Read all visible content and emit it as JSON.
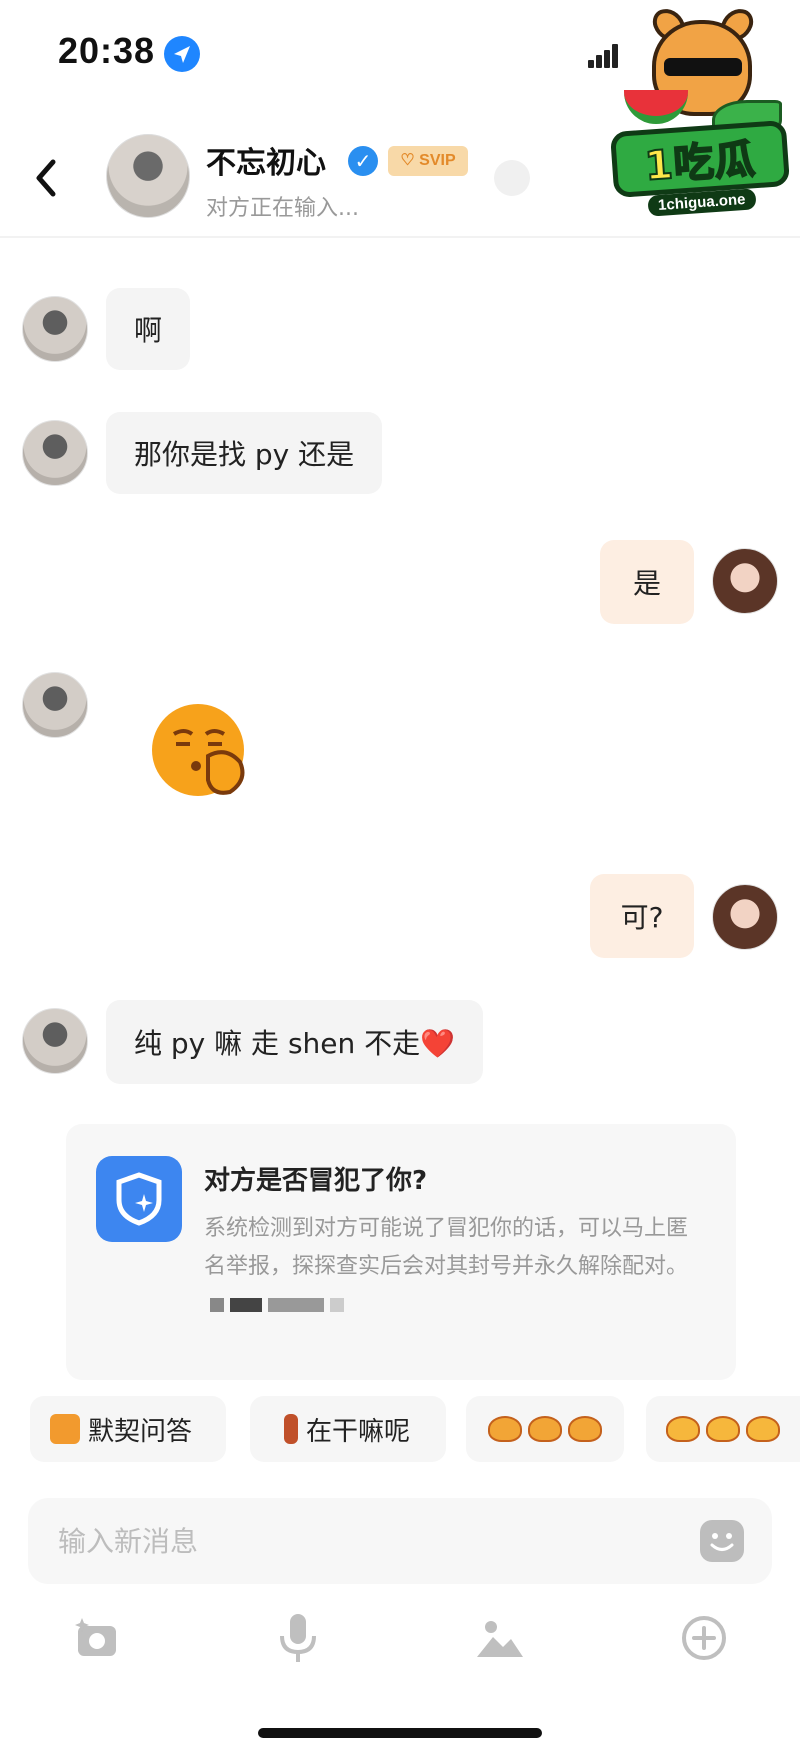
{
  "status_bar": {
    "time": "20:38",
    "location_icon": "location-arrow-icon",
    "signal_icon": "cellular-signal-icon"
  },
  "watermark": {
    "brand": "1吃瓜",
    "url": "1chigua.one"
  },
  "header": {
    "back_icon": "chevron-left-icon",
    "contact_name": "不忘初心",
    "verified_icon": "verified-check-icon",
    "vip_badge": "SVIP",
    "status": "对方正在输入..."
  },
  "messages": [
    {
      "side": "in",
      "text": "啊"
    },
    {
      "side": "in",
      "text": "那你是找 py 还是"
    },
    {
      "side": "out",
      "text": "是"
    },
    {
      "side": "in",
      "emoji": "pensive-finger-emoji"
    },
    {
      "side": "out",
      "text": "可?"
    },
    {
      "side": "in",
      "text": "纯 py 嘛 走 shen 不走❤️"
    }
  ],
  "report_card": {
    "icon": "shield-star-icon",
    "title": "对方是否冒犯了你?",
    "body": "系统检测到对方可能说了冒犯你的话，可以马上匿名举报，探探查实后会对其封号并永久解除配对。"
  },
  "quick_replies": [
    {
      "label": "默契问答",
      "icon": "quiz-pencil-icon"
    },
    {
      "label": "在干嘛呢",
      "icon": "lipstick-icon"
    },
    {
      "label": "",
      "icon": "frog-stickers-icon"
    },
    {
      "label": "",
      "icon": "frog-stickers-icon"
    }
  ],
  "input": {
    "placeholder": "输入新消息",
    "emoji_icon": "smiley-icon"
  },
  "toolbar": [
    {
      "icon": "camera-sparkle-icon"
    },
    {
      "icon": "microphone-icon"
    },
    {
      "icon": "image-icon"
    },
    {
      "icon": "plus-circle-icon"
    }
  ],
  "colors": {
    "accent_blue": "#3d86f0",
    "outgoing_bubble": "#fdeee2",
    "incoming_bubble": "#f4f4f4",
    "svip_bg": "#f8d9a8",
    "svip_text": "#e38a2a"
  }
}
